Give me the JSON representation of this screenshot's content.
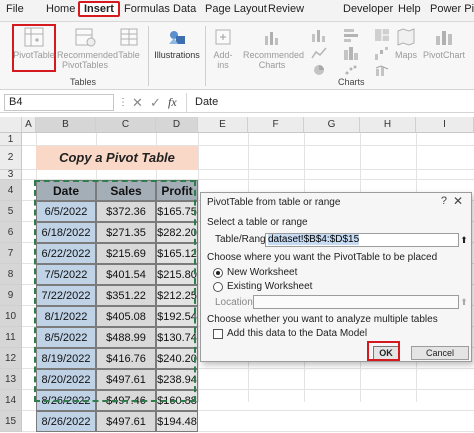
{
  "menu": {
    "items": [
      "File",
      "Home",
      "Insert",
      "Formulas",
      "Data",
      "Page Layout",
      "Review",
      "Developer",
      "Help",
      "Power Pivo"
    ]
  },
  "ribbon": {
    "pivottable": "PivotTable",
    "recommended_pivottables_1": "Recommended",
    "recommended_pivottables_2": "PivotTables",
    "table": "Table",
    "illustrations": "Illustrations",
    "addins_1": "Add-",
    "addins_2": "ins",
    "recommended_charts_1": "Recommended",
    "recommended_charts_2": "Charts",
    "maps": "Maps",
    "pivotchart": "PivotChart",
    "group_tables": "Tables",
    "group_charts": "Charts"
  },
  "formula_bar": {
    "namebox": "B4",
    "value": "Date"
  },
  "columns": [
    "A",
    "B",
    "C",
    "D",
    "E",
    "F",
    "G",
    "H",
    "I"
  ],
  "rows": [
    "1",
    "2",
    "3",
    "4",
    "5",
    "6",
    "7",
    "8",
    "9",
    "10",
    "11",
    "12",
    "13",
    "14",
    "15"
  ],
  "sheet": {
    "title": "Copy a Pivot Table",
    "headers": [
      "Date",
      "Sales",
      "Profit"
    ],
    "data": [
      [
        "6/5/2022",
        "$372.36",
        "$165.75"
      ],
      [
        "6/18/2022",
        "$271.35",
        "$282.20"
      ],
      [
        "6/22/2022",
        "$215.69",
        "$165.12"
      ],
      [
        "7/5/2022",
        "$401.54",
        "$215.80"
      ],
      [
        "7/22/2022",
        "$351.22",
        "$212.25"
      ],
      [
        "8/1/2022",
        "$405.08",
        "$192.54"
      ],
      [
        "8/5/2022",
        "$488.99",
        "$130.74"
      ],
      [
        "8/19/2022",
        "$416.76",
        "$240.20"
      ],
      [
        "8/20/2022",
        "$497.61",
        "$238.94"
      ],
      [
        "8/26/2022",
        "$497.46",
        "$160.88"
      ],
      [
        "8/26/2022",
        "$497.61",
        "$194.48"
      ]
    ]
  },
  "dialog": {
    "title": "PivotTable from table or range",
    "help": "?",
    "close": "✕",
    "select_section": "Select a table or range",
    "table_range_label": "Table/Range:",
    "table_range_value": "dataset!$B$4:$D$15",
    "place_section": "Choose where you want the PivotTable to be placed",
    "new_worksheet": "New Worksheet",
    "existing_worksheet": "Existing Worksheet",
    "location_label": "Location:",
    "analyze_section": "Choose whether you want to analyze multiple tables",
    "data_model_label": "Add this data to the Data Model",
    "ok": "OK",
    "cancel": "Cancel"
  },
  "colors": {
    "highlight_red": "#d6191f",
    "title_fill": "#f9d8c7",
    "header_fill": "#a4aeb7",
    "date_fill": "#bfd2e6",
    "marquee": "#2e7d4a"
  }
}
